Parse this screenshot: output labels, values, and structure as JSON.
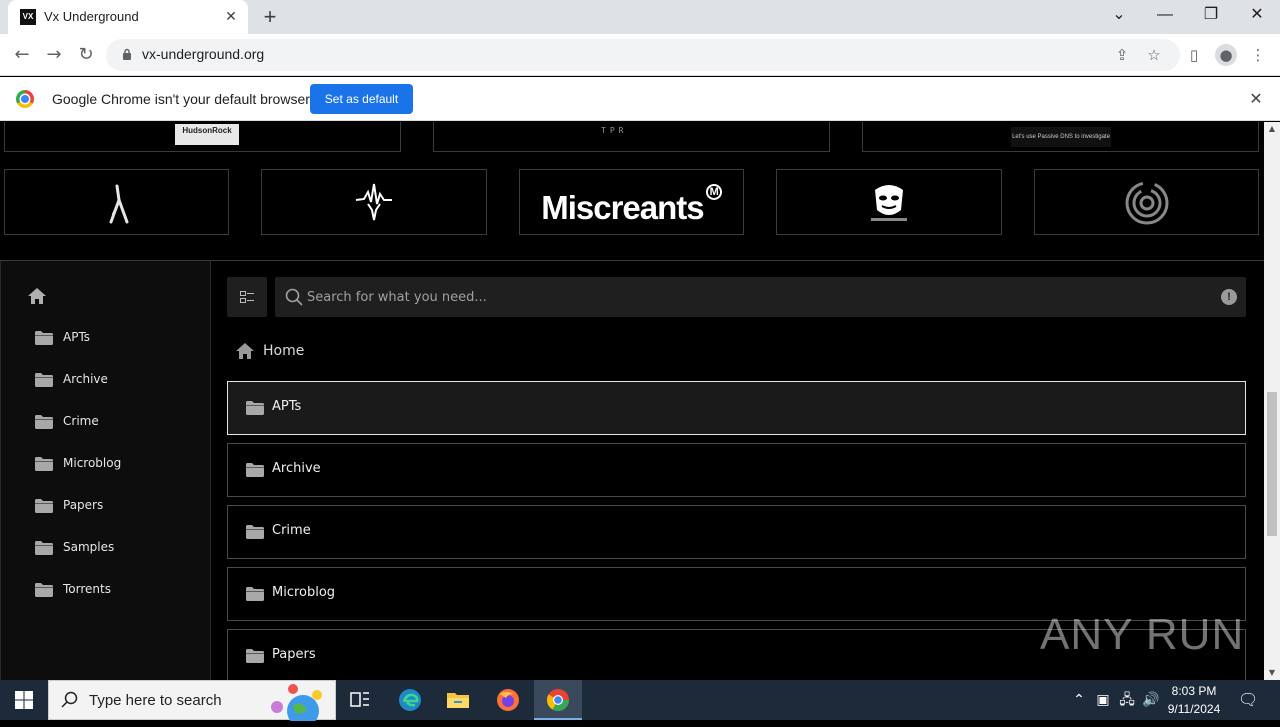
{
  "browser": {
    "tab_title": "Vx Underground",
    "tab_favicon_text": "VX",
    "url": "vx-underground.org",
    "window_controls": [
      "minimize",
      "restore",
      "close"
    ]
  },
  "infobar": {
    "message": "Google Chrome isn't your default browser",
    "button_label": "Set as default"
  },
  "sponsors": {
    "row1": [
      "HudsonRock",
      "TPR",
      "Let's use Passive DNS to investigate"
    ],
    "hudson_text": "HudsonRock",
    "tpr_text": "TPR",
    "passive_text": "Let's use Passive DNS to investigate",
    "miscreants_text": "Miscreants",
    "miscreants_badge": "M"
  },
  "search": {
    "placeholder": "Search for what you need..."
  },
  "breadcrumb": {
    "label": "Home"
  },
  "sidebar": {
    "items": [
      {
        "label": "APTs"
      },
      {
        "label": "Archive"
      },
      {
        "label": "Crime"
      },
      {
        "label": "Microblog"
      },
      {
        "label": "Papers"
      },
      {
        "label": "Samples"
      },
      {
        "label": "Torrents"
      }
    ]
  },
  "listing": {
    "rows": [
      {
        "label": "APTs"
      },
      {
        "label": "Archive"
      },
      {
        "label": "Crime"
      },
      {
        "label": "Microblog"
      },
      {
        "label": "Papers"
      }
    ]
  },
  "watermark": "ANY RUN",
  "taskbar": {
    "search_placeholder": "Type here to search",
    "time": "8:03 PM",
    "date": "9/11/2024"
  },
  "colors": {
    "accent_blue": "#1a73e8",
    "page_bg": "#000000",
    "taskbar_bg": "#1c2a3a"
  }
}
